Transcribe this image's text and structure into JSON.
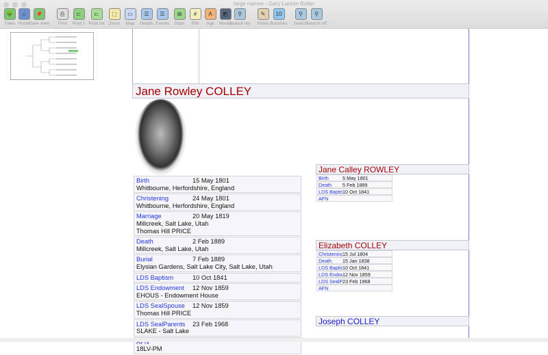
{
  "window": {
    "title": "large names - Gary Larson Butler"
  },
  "toolbar": [
    {
      "label": "Trees",
      "icon": "trees-icon",
      "glyph": "🌳",
      "color": "#7bc96f"
    },
    {
      "label": "Home",
      "icon": "home-icon",
      "glyph": "⌂",
      "color": "#6d8fcf"
    },
    {
      "label": "Save view",
      "icon": "pin-icon",
      "glyph": "📌",
      "color": "#7bc96f"
    },
    {
      "label": "Print",
      "icon": "printer-icon",
      "glyph": "⎙",
      "color": "#ddd"
    },
    {
      "label": "Root 1",
      "icon": "root-icon",
      "glyph": "⊏",
      "color": "#8fd080"
    },
    {
      "label": "Root list",
      "icon": "root-list-icon",
      "glyph": "⊏",
      "color": "#a8dd98"
    },
    {
      "label": "Zoom",
      "icon": "zoom-icon",
      "glyph": "⬚",
      "color": "#f5e9a8"
    },
    {
      "label": "Map",
      "icon": "map-icon",
      "glyph": "▭",
      "color": "#c8d8f5"
    },
    {
      "label": "Details",
      "icon": "details-icon",
      "glyph": "☰",
      "color": "#a9c8ef"
    },
    {
      "label": "Events",
      "icon": "events-icon",
      "glyph": "☰",
      "color": "#a9c8ef"
    },
    {
      "label": "Dups",
      "icon": "dups-icon",
      "glyph": "⊞",
      "color": "#9cd88c"
    },
    {
      "label": "RIN",
      "icon": "rin-icon",
      "glyph": "#",
      "color": "#f5efc0"
    },
    {
      "label": "Age",
      "icon": "age-icon",
      "glyph": "A",
      "color": "#f3b27a"
    },
    {
      "label": "Media",
      "icon": "media-icon",
      "glyph": "◩",
      "color": "#55677f"
    },
    {
      "label": "Search list",
      "icon": "search-list-icon",
      "glyph": "⚲",
      "color": "#a8c8e0"
    },
    {
      "label": "Notes",
      "icon": "notes-icon",
      "glyph": "✎",
      "color": "#e0d0b0"
    },
    {
      "label": "Bunches",
      "icon": "bunches-icon",
      "glyph": "10",
      "color": "#8cc8f0"
    },
    {
      "label": "Search",
      "icon": "search-icon",
      "glyph": "⚲",
      "color": "#a8c8e0"
    },
    {
      "label": "Search off",
      "icon": "search-off-icon",
      "glyph": "⚲",
      "color": "#a8c8e0"
    }
  ],
  "person": {
    "name": "Jane Rowley COLLEY",
    "events": [
      {
        "label": "Birth",
        "date": "15 May 1801",
        "lines": [
          "Whitbourne, Herfordshire, England"
        ]
      },
      {
        "label": "Christening",
        "date": "24 May 1801",
        "lines": [
          "Whitbourne, Herfordshire, England"
        ]
      },
      {
        "label": "Marriage",
        "date": "20 May 1819",
        "lines": [
          "Millcreek, Salt Lake, Utah",
          "Thomas Hill PRICE"
        ]
      },
      {
        "label": "Death",
        "date": "2 Feb 1889",
        "lines": [
          "Millcreek, Salt Lake, Utah"
        ]
      },
      {
        "label": "Burial",
        "date": "7 Feb 1889",
        "lines": [
          "Elysian Gardens, Salt Lake City, Salt Lake, Utah"
        ]
      },
      {
        "label": "LDS Baptism",
        "date": "10 Oct 1841",
        "lines": []
      },
      {
        "label": "LDS Endowment",
        "date": "12 Nov 1859",
        "lines": [
          "EHOUS - Endowment House"
        ]
      },
      {
        "label": "LDS SealSpouse",
        "date": "12 Nov 1859",
        "lines": [
          "Thomas Hill PRICE"
        ]
      },
      {
        "label": "LDS SealParents",
        "date": "23 Feb 1968",
        "lines": [
          "SLAKE - Salt Lake"
        ]
      },
      {
        "label": "AFN",
        "date": "",
        "lines": [
          "18LV-PM"
        ]
      }
    ]
  },
  "relatives": [
    {
      "name": "Jane Calley ROWLEY",
      "color": "#a40000",
      "events": [
        {
          "label": "Birth",
          "date": "5 May 1801"
        },
        {
          "label": "Death",
          "date": "5 Feb 1889"
        },
        {
          "label": "LDS Baptism",
          "date": "10 Oct 1841"
        },
        {
          "label": "AFN",
          "date": ""
        }
      ]
    },
    {
      "name": "Elizabeth COLLEY",
      "color": "#a40000",
      "events": [
        {
          "label": "Christening",
          "date": "15 Jul 1804"
        },
        {
          "label": "Death",
          "date": "15 Jan 1838"
        },
        {
          "label": "LDS Baptism",
          "date": "10 Oct 1841"
        },
        {
          "label": "LDS Endowment",
          "date": "12 Nov 1859"
        },
        {
          "label": "LDS SealParents",
          "date": "23 Feb 1968"
        },
        {
          "label": "AFN",
          "date": ""
        }
      ]
    },
    {
      "name": "Joseph COLLEY",
      "color": "#1a1acc",
      "events": []
    }
  ]
}
